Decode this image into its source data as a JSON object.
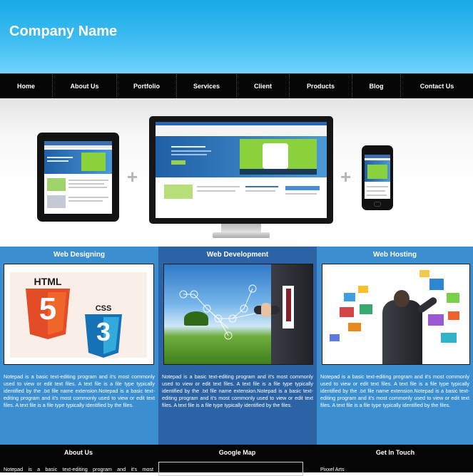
{
  "header": {
    "company_name": "Company Name"
  },
  "nav": {
    "items": [
      "Home",
      "About Us",
      "Portfolio",
      "Services",
      "Client",
      "Products",
      "Blog",
      "Contact Us"
    ]
  },
  "services": [
    {
      "title": "Web Designing",
      "image": "html5-css3-logos",
      "text": "Notepad is a basic text-editing program and it's most commonly used to view or edit text files. A text file is a file type typically identified by the .txt file name extension.Notepad is a basic text-editing program and it's most commonly used to view or edit text files. A text file is a file type typically identified by the files."
    },
    {
      "title": "Web Development",
      "image": "businessman-touching-network",
      "text": "Notepad is a basic text-editing program and it's most commonly used to view or edit text files. A text file is a file type typically identified by the .txt file name extension.Notepad is a basic text-editing program and it's most commonly used to view or edit text files. A text file is a file type typically identified by the files."
    },
    {
      "title": "Web Hosting",
      "image": "man-with-floating-screens",
      "text": "Notepad is a basic text-editing program and it's most commonly used to view or edit text files. A text file is a file type typically identified by the .txt file name extension.Notepad is a basic text-editing program and it's most commonly used to view or edit text files. A text file is a file type typically identified by the files."
    }
  ],
  "html5_logo": {
    "word": "HTML",
    "digit": "5"
  },
  "css3_logo": {
    "word": "CSS",
    "digit": "3"
  },
  "footer": {
    "about_title": "About Us",
    "about_text": "Notepad is a basic text-editing program and it's most",
    "map_title": "Google Map",
    "contact_title": "Get In Touch",
    "contact_text": "Pixxel Arts"
  },
  "colors": {
    "header_top": "#17a9e8",
    "nav_bg": "#050505",
    "service_blue": "#3b8fd0",
    "service_dark": "#2b63a4",
    "html5_orange": "#e34c26",
    "css3_blue": "#1572b6"
  }
}
